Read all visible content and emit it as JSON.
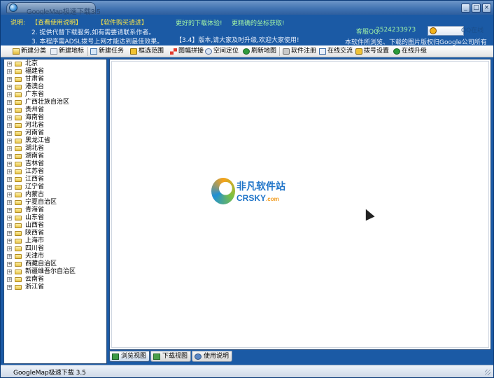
{
  "window": {
    "title": "GoogleMap极速下载3.5",
    "controls": [
      "_",
      "□",
      "×"
    ]
  },
  "banner": {
    "label": "说明:",
    "link_guide": "【查看使用说明】",
    "link_buy": "【软件购买请进】",
    "slogan_1": "更好的下载体验!",
    "slogan_2": "更精确的坐标获取!",
    "line_2": "2. 提供代替下载服务,如有需要请联系作者。",
    "line_3": "3. 本程序需ADSL拨号上网才能达到最佳效果。",
    "version_note": "【3.4】版本,请大家及时升级,欢迎大家使用!",
    "qq_label": "客服QQ:",
    "qq_number": "2524233973",
    "qq_button": "QQ在线",
    "copyright": "本软件所浏览、下载的图片版权归Google公司所有"
  },
  "toolbar": {
    "items": [
      {
        "label": "新建分类",
        "icon": "folder-icon"
      },
      {
        "label": "新建地标",
        "icon": "marker-icon"
      },
      {
        "label": "新建任务",
        "icon": "task-icon"
      },
      {
        "label": "框选范围",
        "icon": "select-range-icon"
      },
      {
        "label": "图幅拼接",
        "icon": "mosaic-icon"
      },
      {
        "label": "空间定位",
        "icon": "locate-icon"
      },
      {
        "label": "刷新地图",
        "icon": "refresh-icon"
      },
      {
        "label": "软件注册",
        "icon": "register-icon"
      },
      {
        "label": "在线交流",
        "icon": "chat-icon"
      },
      {
        "label": "拨号设置",
        "icon": "dial-icon"
      },
      {
        "label": "在线升级",
        "icon": "upgrade-icon"
      }
    ]
  },
  "tree": {
    "items": [
      "北京",
      "福建省",
      "甘肃省",
      "港澳台",
      "广东省",
      "广西壮族自治区",
      "贵州省",
      "海南省",
      "河北省",
      "河南省",
      "黑龙江省",
      "湖北省",
      "湖南省",
      "吉林省",
      "江苏省",
      "江西省",
      "辽宁省",
      "内蒙古",
      "宁夏自治区",
      "青海省",
      "山东省",
      "山西省",
      "陕西省",
      "上海市",
      "四川省",
      "天津市",
      "西藏自治区",
      "新疆维吾尔自治区",
      "云南省",
      "浙江省"
    ]
  },
  "watermark": {
    "cn": "非凡软件站",
    "en": "CRSKY",
    "en_suffix": ".com"
  },
  "tabs": [
    {
      "label": "浏览视图",
      "active": true
    },
    {
      "label": "下载视图",
      "active": false
    },
    {
      "label": "使用说明",
      "active": false
    }
  ],
  "status": {
    "text": "GoogleMap极速下载 3.5"
  }
}
